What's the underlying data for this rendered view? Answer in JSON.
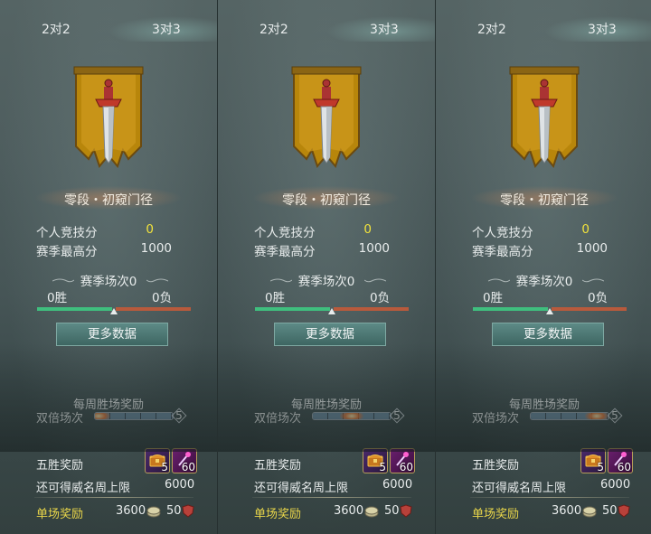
{
  "colors": {
    "win": "#3fbf7e",
    "loss": "#b85a3c",
    "highlight": "#f2e33c",
    "reward_label": "#e9d64a"
  },
  "panels": [
    {
      "tabs": {
        "left": "2对2",
        "right": "3对3"
      },
      "rank_name": "零段・初窥门径",
      "personal_score_label": "个人竞技分",
      "personal_score": "0",
      "season_best_label": "赛季最高分",
      "season_best": "1000",
      "season_matches": "赛季场次0",
      "wins": "0胜",
      "losses": "0负",
      "win_ratio": 0.5,
      "more_button": "更多数据",
      "weekly_title": "每周胜场奖励",
      "double_label": "双倍场次",
      "double_max": "5",
      "double_effect": 0.05,
      "five_win_label": "五胜奖励",
      "item1_count": "5",
      "item2_count": "60",
      "limit_label": "还可得威名周上限",
      "limit_value": "6000",
      "single_label": "单场奖励",
      "single_coin": "3600",
      "single_shield": "50"
    },
    {
      "tabs": {
        "left": "2对2",
        "right": "3对3"
      },
      "rank_name": "零段・初窥门径",
      "personal_score_label": "个人竞技分",
      "personal_score": "0",
      "season_best_label": "赛季最高分",
      "season_best": "1000",
      "season_matches": "赛季场次0",
      "wins": "0胜",
      "losses": "0负",
      "win_ratio": 0.5,
      "more_button": "更多数据",
      "weekly_title": "每周胜场奖励",
      "double_label": "双倍场次",
      "double_max": "5",
      "double_effect": 0.5,
      "five_win_label": "五胜奖励",
      "item1_count": "5",
      "item2_count": "60",
      "limit_label": "还可得威名周上限",
      "limit_value": "6000",
      "single_label": "单场奖励",
      "single_coin": "3600",
      "single_shield": "50"
    },
    {
      "tabs": {
        "left": "2对2",
        "right": "3对3"
      },
      "rank_name": "零段・初窥门径",
      "personal_score_label": "个人竞技分",
      "personal_score": "0",
      "season_best_label": "赛季最高分",
      "season_best": "1000",
      "season_matches": "赛季场次0",
      "wins": "0胜",
      "losses": "0负",
      "win_ratio": 0.5,
      "more_button": "更多数据",
      "weekly_title": "每周胜场奖励",
      "double_label": "双倍场次",
      "double_max": "5",
      "double_effect": 0.85,
      "five_win_label": "五胜奖励",
      "item1_count": "5",
      "item2_count": "60",
      "limit_label": "还可得威名周上限",
      "limit_value": "6000",
      "single_label": "单场奖励",
      "single_coin": "3600",
      "single_shield": "50"
    }
  ]
}
